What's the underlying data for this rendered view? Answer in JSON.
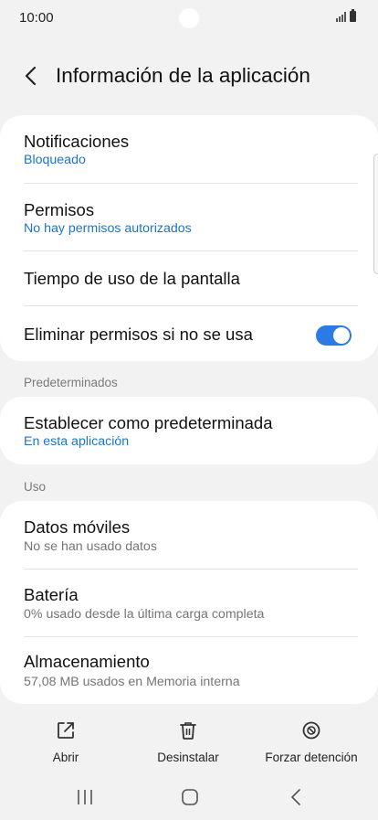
{
  "status_bar": {
    "time": "10:00"
  },
  "header": {
    "title": "Información de la aplicación"
  },
  "settings": {
    "notifications": {
      "title": "Notificaciones",
      "subtitle": "Bloqueado"
    },
    "permissions": {
      "title": "Permisos",
      "subtitle": "No hay permisos autorizados"
    },
    "screen_time": {
      "title": "Tiempo de uso de la pantalla"
    },
    "remove_permissions": {
      "title": "Eliminar permisos si no se usa",
      "enabled": true
    }
  },
  "defaults_section": {
    "label": "Predeterminados",
    "set_default": {
      "title": "Establecer como predeterminada",
      "subtitle": "En esta aplicación"
    }
  },
  "usage_section": {
    "label": "Uso",
    "mobile_data": {
      "title": "Datos móviles",
      "subtitle": "No se han usado datos"
    },
    "battery": {
      "title": "Batería",
      "subtitle": "0% usado desde la última carga completa"
    },
    "storage": {
      "title": "Almacenamiento",
      "subtitle": "57,08 MB usados en Memoria interna"
    }
  },
  "actions": {
    "open": "Abrir",
    "uninstall": "Desinstalar",
    "force_stop": "Forzar detención"
  },
  "colors": {
    "accent": "#1b74c9",
    "toggle_on": "#2c7be5",
    "background": "#f2f2f2"
  }
}
